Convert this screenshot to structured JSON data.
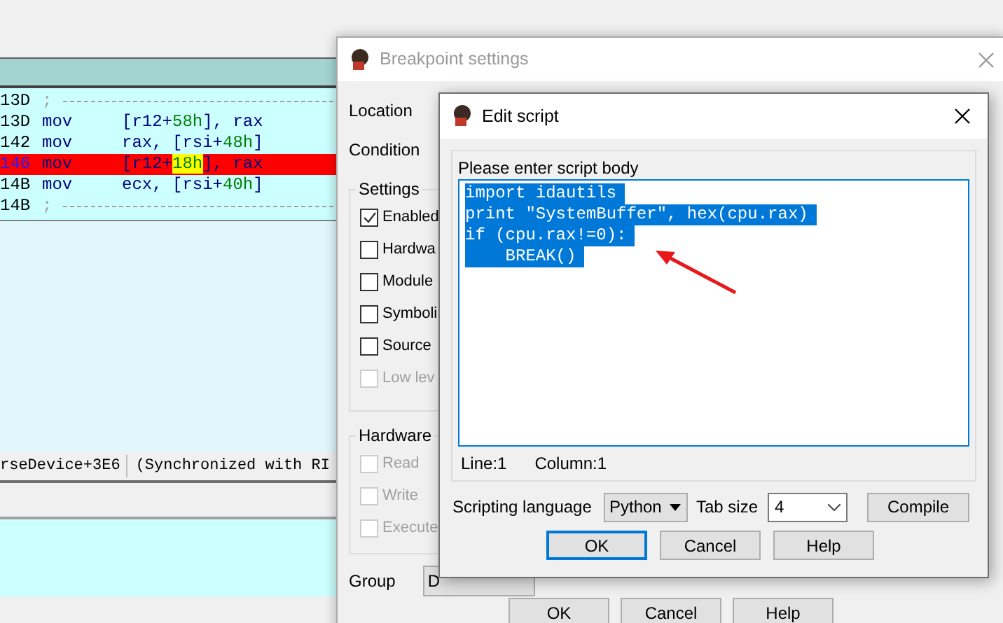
{
  "disassembly": {
    "lines": [
      {
        "address": "13D",
        "kind": "comment",
        "mnemonic": ";",
        "breakpoint": false
      },
      {
        "address": "13D",
        "kind": "instruction",
        "mnemonic": "mov",
        "breakpoint": false,
        "operands": [
          {
            "text": "[r12+",
            "kind": "plain"
          },
          {
            "text": "58h",
            "kind": "number"
          },
          {
            "text": "], rax",
            "kind": "plain"
          }
        ]
      },
      {
        "address": "142",
        "kind": "instruction",
        "mnemonic": "mov",
        "breakpoint": false,
        "operands": [
          {
            "text": "rax, [rsi+",
            "kind": "plain"
          },
          {
            "text": "48h",
            "kind": "number"
          },
          {
            "text": "]",
            "kind": "plain"
          }
        ]
      },
      {
        "address": "146",
        "kind": "instruction",
        "mnemonic": "mov",
        "breakpoint": true,
        "operands": [
          {
            "text": "[r12+",
            "kind": "plain"
          },
          {
            "text": "18h",
            "kind": "highlight"
          },
          {
            "text": "], rax",
            "kind": "plain"
          }
        ]
      },
      {
        "address": "14B",
        "kind": "instruction",
        "mnemonic": "mov",
        "breakpoint": false,
        "operands": [
          {
            "text": "ecx, [rsi+",
            "kind": "plain"
          },
          {
            "text": "40h",
            "kind": "number"
          },
          {
            "text": "]",
            "kind": "plain"
          }
        ]
      },
      {
        "address": "14B",
        "kind": "comment",
        "mnemonic": ";",
        "breakpoint": false
      }
    ]
  },
  "status_line": {
    "location": "rseDevice+3E6",
    "note": "(Synchronized with RI"
  },
  "breakpoint_dialog": {
    "title": "Breakpoint settings",
    "fields": [
      {
        "label": "Location"
      },
      {
        "label": "Condition"
      }
    ],
    "settings_group": {
      "title": "Settings",
      "options": [
        {
          "label": "Enabled",
          "checked": true,
          "disabled": false
        },
        {
          "label": "Hardwa",
          "checked": false,
          "disabled": false
        },
        {
          "label": "Module",
          "checked": false,
          "disabled": false
        },
        {
          "label": "Symboli",
          "checked": false,
          "disabled": false
        },
        {
          "label": "Source",
          "checked": false,
          "disabled": false
        },
        {
          "label": "Low lev",
          "checked": false,
          "disabled": true
        }
      ]
    },
    "hardware_group": {
      "title": "Hardware",
      "options": [
        {
          "label": "Read",
          "checked": false,
          "disabled": true
        },
        {
          "label": "Write",
          "checked": false,
          "disabled": true
        },
        {
          "label": "Execute",
          "checked": false,
          "disabled": true
        }
      ]
    },
    "group": {
      "label": "Group",
      "value": "D"
    },
    "buttons": [
      "OK",
      "Cancel",
      "Help"
    ]
  },
  "edit_script": {
    "title": "Edit script",
    "prompt": "Please enter script body",
    "selected": true,
    "script_lines": [
      "import idautils",
      "print \"SystemBuffer\", hex(cpu.rax)",
      "if (cpu.rax!=0):",
      "    BREAK()"
    ],
    "line": "Line:1",
    "column": "Column:1",
    "language_label": "Scripting language",
    "language": "Python",
    "tab_size_label": "Tab size",
    "tab_size": "4",
    "compile": "Compile",
    "buttons": [
      {
        "label": "OK",
        "focused": true
      },
      {
        "label": "Cancel",
        "focused": false
      },
      {
        "label": "Help",
        "focused": false
      }
    ]
  }
}
